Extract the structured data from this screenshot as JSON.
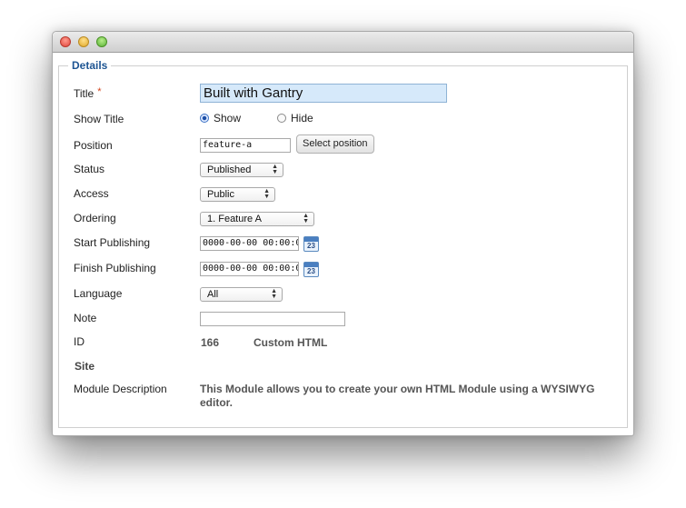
{
  "window": {
    "controls": [
      "close",
      "minimize",
      "maximize"
    ]
  },
  "details": {
    "legend": "Details",
    "fields": {
      "title": {
        "label": "Title",
        "required_mark": "*",
        "value": "Built with Gantry"
      },
      "show_title": {
        "label": "Show Title",
        "options": [
          "Show",
          "Hide"
        ],
        "selected": "Show"
      },
      "position": {
        "label": "Position",
        "value": "feature-a",
        "button": "Select position"
      },
      "status": {
        "label": "Status",
        "value": "Published"
      },
      "access": {
        "label": "Access",
        "value": "Public"
      },
      "ordering": {
        "label": "Ordering",
        "value": "1. Feature A"
      },
      "start_publishing": {
        "label": "Start Publishing",
        "value": "0000-00-00 00:00:0",
        "calendar_day": "23"
      },
      "finish_publishing": {
        "label": "Finish Publishing",
        "value": "0000-00-00 00:00:0",
        "calendar_day": "23"
      },
      "language": {
        "label": "Language",
        "value": "All"
      },
      "note": {
        "label": "Note",
        "value": ""
      },
      "id": {
        "label": "ID",
        "value": "166",
        "type": "Custom HTML"
      },
      "site": {
        "label": "Site"
      },
      "module_description": {
        "label": "Module Description",
        "value": "This Module allows you to create your own HTML Module using a WYSIWYG editor."
      }
    }
  },
  "icons": {
    "calendar": "calendar-icon",
    "dropdown": "updown-arrow-icon"
  },
  "colors": {
    "legend": "#1e5593",
    "required": "#d2441b",
    "title_bg": "#d6e9fa",
    "radio_selected": "#1d4fa6"
  }
}
